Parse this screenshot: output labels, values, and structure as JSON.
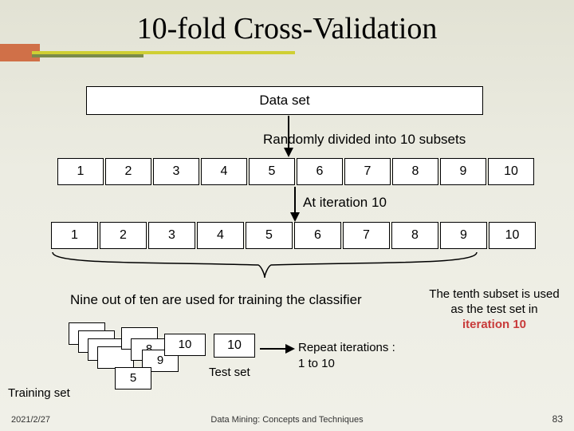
{
  "title": "10-fold Cross-Validation",
  "dataset_label": "Data set",
  "random_label": "Randomly divided into 10 subsets",
  "row1": [
    "1",
    "2",
    "3",
    "4",
    "5",
    "6",
    "7",
    "8",
    "9",
    "10"
  ],
  "iteration_label": "At iteration 10",
  "row2": [
    "1",
    "2",
    "3",
    "4",
    "5",
    "6",
    "7",
    "8",
    "9",
    "10"
  ],
  "nine_label": "Nine out of ten are used for training the classifier",
  "tenth_note_plain1": "The tenth subset is used as the test set in ",
  "tenth_note_hi": "iteration 10",
  "stack_front": [
    "5",
    "9",
    "8",
    "10"
  ],
  "stack_back_count": 4,
  "ten_box": "10",
  "training_label": "Training set",
  "test_label": "Test set",
  "repeat_label_l1": "Repeat iterations :",
  "repeat_label_l2": "1 to 10",
  "footer_date": "2021/2/27",
  "footer_source": "Data Mining: Concepts and Techniques",
  "footer_page": "83",
  "chart_data": {
    "type": "table",
    "title": "10-fold Cross-Validation scheme",
    "folds": 10,
    "highlight_iteration": 10,
    "training_folds_at_iter10": [
      1,
      2,
      3,
      4,
      5,
      6,
      7,
      8,
      9
    ],
    "test_fold_at_iter10": 10,
    "iterations": "1 to 10"
  }
}
